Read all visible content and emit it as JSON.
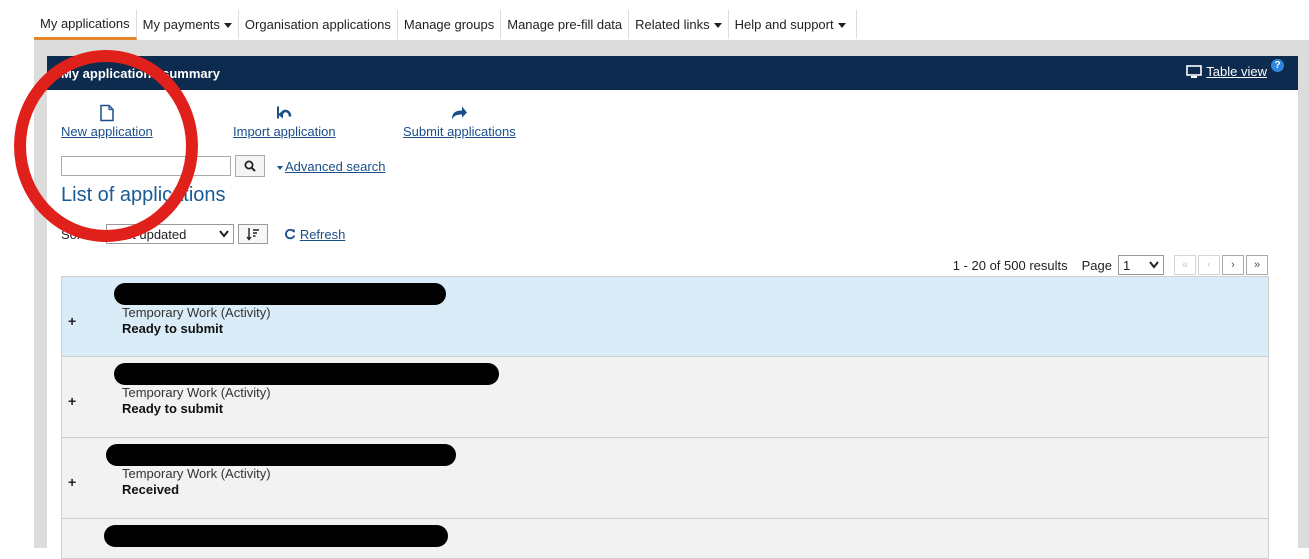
{
  "nav": {
    "tabs": [
      {
        "label": "My applications"
      },
      {
        "label": "My payments"
      },
      {
        "label": "Organisation applications"
      },
      {
        "label": "Manage groups"
      },
      {
        "label": "Manage pre-fill data"
      },
      {
        "label": "Related links"
      },
      {
        "label": "Help and support"
      }
    ]
  },
  "panel": {
    "title": "My applications summary",
    "table_view": "Table view",
    "help": "?"
  },
  "actions": {
    "new": "New application",
    "import": "Import application",
    "submit": "Submit applications"
  },
  "search": {
    "value": "",
    "advanced": "Advanced search"
  },
  "list": {
    "title": "List of applications",
    "sort_label": "Sort by",
    "sort_value": "Last updated",
    "refresh": "Refresh"
  },
  "pagination": {
    "results": "1 - 20 of 500 results",
    "page_label": "Page",
    "page_value": "1"
  },
  "applications": [
    {
      "type": "Temporary Work (Activity)",
      "status": "Ready to submit"
    },
    {
      "type": "Temporary Work (Activity)",
      "status": "Ready to submit"
    },
    {
      "type": "Temporary Work (Activity)",
      "status": "Received"
    }
  ],
  "colors": {
    "header_bg": "#0d2b4e",
    "active_tab_underline": "#e5872c",
    "link": "#1a4f8a",
    "selected_row": "#d9ecf8",
    "annotation_circle": "#e0201b"
  }
}
